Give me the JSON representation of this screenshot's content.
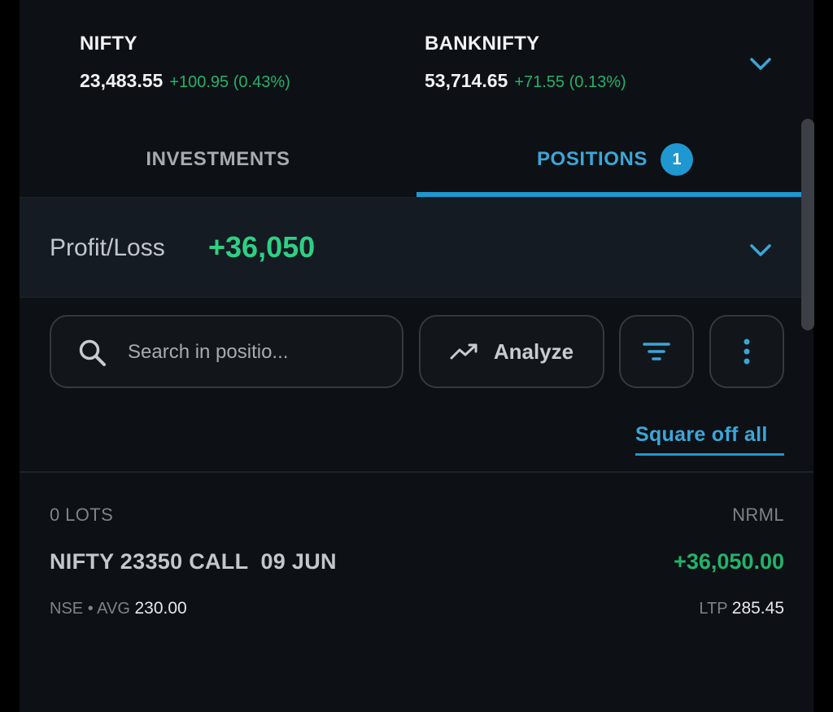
{
  "ticker": {
    "indices": [
      {
        "name": "NIFTY",
        "value": "23,483.55",
        "change": "+100.95 (0.43%)"
      },
      {
        "name": "BANKNIFTY",
        "value": "53,714.65",
        "change": "+71.55 (0.13%)"
      }
    ],
    "expand_icon": "chevron-down-icon"
  },
  "tabs": {
    "investments": "INVESTMENTS",
    "positions": "POSITIONS",
    "positions_count": "1"
  },
  "pnl": {
    "label": "Profit/Loss",
    "value": "+36,050"
  },
  "toolbar": {
    "search_placeholder": "Search in positio...",
    "analyze_label": "Analyze",
    "filter_icon": "filter-icon",
    "more_icon": "more-vertical-icon"
  },
  "square_off_all": "Square off all",
  "positions": [
    {
      "lots": "0 LOTS",
      "product": "NRML",
      "symbol": "NIFTY 23350 CALL  09 JUN",
      "pnl": "+36,050.00",
      "exchange": "NSE",
      "separator": "•",
      "avg_label": "AVG",
      "avg_value": "230.00",
      "ltp_label": "LTP",
      "ltp_value": "285.45"
    }
  ],
  "colors": {
    "background": "#0d1014",
    "accent": "#1f97d1",
    "profit": "#21b36b"
  }
}
